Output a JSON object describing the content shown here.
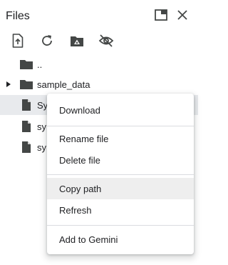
{
  "header": {
    "title": "Files"
  },
  "toolbar": {
    "icons": [
      "upload-icon",
      "refresh-icon",
      "mount-drive-icon",
      "hide-files-icon"
    ]
  },
  "tree": {
    "items": [
      {
        "label": "..",
        "type": "folder"
      },
      {
        "label": "sample_data",
        "type": "folder",
        "expandable": true
      },
      {
        "label": "Sy",
        "type": "file",
        "selected": true
      },
      {
        "label": "sy",
        "type": "file"
      },
      {
        "label": "sy",
        "type": "file"
      }
    ]
  },
  "context_menu": {
    "items": [
      {
        "label": "Download"
      },
      {
        "label": "Rename file"
      },
      {
        "label": "Delete file"
      },
      {
        "label": "Copy path",
        "highlighted": true
      },
      {
        "label": "Refresh"
      },
      {
        "label": "Add to Gemini"
      }
    ]
  },
  "colors": {
    "text": "#202124",
    "icon": "#444746",
    "selected_row": "#e8eaed",
    "menu_hover": "#eeeeee",
    "divider": "#dadce0"
  }
}
